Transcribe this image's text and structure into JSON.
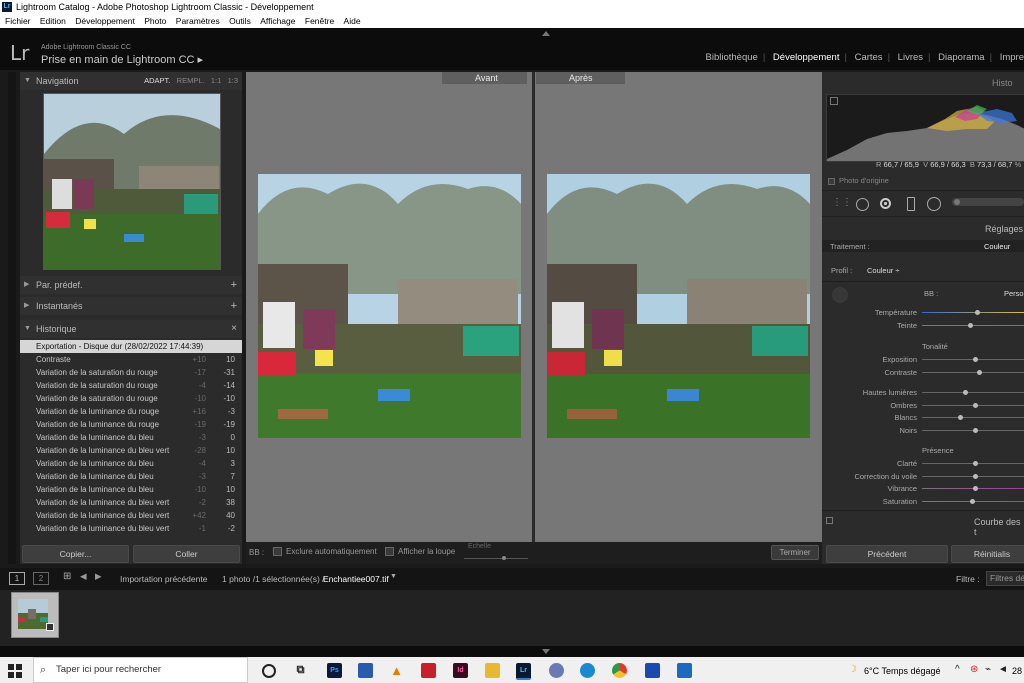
{
  "window": {
    "title": "Lightroom Catalog - Adobe Photoshop Lightroom Classic - Développement"
  },
  "menu": [
    "Fichier",
    "Edition",
    "Développement",
    "Photo",
    "Paramètres",
    "Outils",
    "Affichage",
    "Fenêtre",
    "Aide"
  ],
  "identity": {
    "logo": "Lr",
    "subtitle": "Adobe Lightroom Classic CC",
    "title": "Prise en main de Lightroom CC ▸"
  },
  "modules": {
    "items": [
      "Bibliothèque",
      "Développement",
      "Cartes",
      "Livres",
      "Diaporama",
      "Impre"
    ],
    "active": "Développement"
  },
  "left_panel": {
    "navigation": {
      "label": "Navigation",
      "options": [
        "ADAPT.",
        "REMPL.",
        "1:1",
        "1:3"
      ]
    },
    "presets": {
      "label": "Par. prédef."
    },
    "snapshots": {
      "label": "Instantanés"
    },
    "history": {
      "label": "Historique",
      "items": [
        {
          "name": "Exportation - Disque dur (28/02/2022 17:44:39)",
          "a": "",
          "b": ""
        },
        {
          "name": "Contraste",
          "a": "+10",
          "b": "10"
        },
        {
          "name": "Variation de la saturation du rouge",
          "a": "-17",
          "b": "-31"
        },
        {
          "name": "Variation de la saturation du rouge",
          "a": "-4",
          "b": "-14"
        },
        {
          "name": "Variation de la saturation du rouge",
          "a": "-10",
          "b": "-10"
        },
        {
          "name": "Variation de la luminance du rouge",
          "a": "+16",
          "b": "-3"
        },
        {
          "name": "Variation de la luminance du rouge",
          "a": "-19",
          "b": "-19"
        },
        {
          "name": "Variation de la luminance du bleu",
          "a": "-3",
          "b": "0"
        },
        {
          "name": "Variation de la luminance du bleu vert",
          "a": "-28",
          "b": "10"
        },
        {
          "name": "Variation de la luminance du bleu",
          "a": "-4",
          "b": "3"
        },
        {
          "name": "Variation de la luminance du bleu",
          "a": "-3",
          "b": "7"
        },
        {
          "name": "Variation de la luminance du bleu",
          "a": "-10",
          "b": "10"
        },
        {
          "name": "Variation de la luminance du bleu vert",
          "a": "-2",
          "b": "38"
        },
        {
          "name": "Variation de la luminance du bleu vert",
          "a": "+42",
          "b": "40"
        },
        {
          "name": "Variation de la luminance du bleu vert",
          "a": "-1",
          "b": "-2"
        }
      ]
    },
    "copy_button": "Copier...",
    "paste_button": "Coller"
  },
  "center": {
    "before_label": "Avant",
    "after_label": "Après",
    "toolbar": {
      "bb": "BB :",
      "auto_exclude": "Exclure automatiquement",
      "show_loupe": "Afficher la loupe",
      "scale": "Echelle",
      "done": "Terminer"
    }
  },
  "right_panel": {
    "histogram_label": "Histo",
    "rgb_readout": {
      "r_label": "R",
      "r": "66,7 / 65,9",
      "g_label": "V",
      "g": "66,9 / 66,3",
      "b_label": "B",
      "b": "73,3 / 68,7",
      "unit": "%"
    },
    "original_photo": "Photo d'origine",
    "settings_label": "Réglages",
    "treatment_label": "Traitement :",
    "treatment_value": "Couleur",
    "profile_label": "Profil :",
    "profile_value": "Couleur ÷",
    "wb_label": "BB :",
    "wb_value": "Perso",
    "sliders_wb": [
      {
        "name": "Température",
        "value": 0.55
      },
      {
        "name": "Teinte",
        "value": 0.48
      }
    ],
    "tone_label": "Tonalité",
    "sliders_tone": [
      {
        "name": "Exposition",
        "value": 0.53
      },
      {
        "name": "Contraste",
        "value": 0.57
      }
    ],
    "sliders_tone2": [
      {
        "name": "Hautes lumières",
        "value": 0.43
      },
      {
        "name": "Ombres",
        "value": 0.53
      },
      {
        "name": "Blancs",
        "value": 0.38
      },
      {
        "name": "Noirs",
        "value": 0.53
      }
    ],
    "presence_label": "Présence",
    "sliders_presence": [
      {
        "name": "Clarté",
        "value": 0.53
      },
      {
        "name": "Correction du voile",
        "value": 0.53
      },
      {
        "name": "Vibrance",
        "value": 0.53
      },
      {
        "name": "Saturation",
        "value": 0.5
      }
    ],
    "curve_label": "Courbe des t",
    "prev_button": "Précédent",
    "reset_button": "Réinitialis"
  },
  "filmstrip": {
    "view1": "1",
    "view2": "2",
    "source": "Importation précédente",
    "status": "1 photo /1 sélectionnée(s) /",
    "filename": "Enchantiee007.tif",
    "filter_label": "Filtre :",
    "filter_value": "Filtres dés"
  },
  "taskbar": {
    "search_placeholder": "Taper ici pour rechercher",
    "apps": [
      "Ps",
      "Id",
      "Lr"
    ],
    "weather": "6°C  Temps dégagé",
    "clock": "28"
  }
}
